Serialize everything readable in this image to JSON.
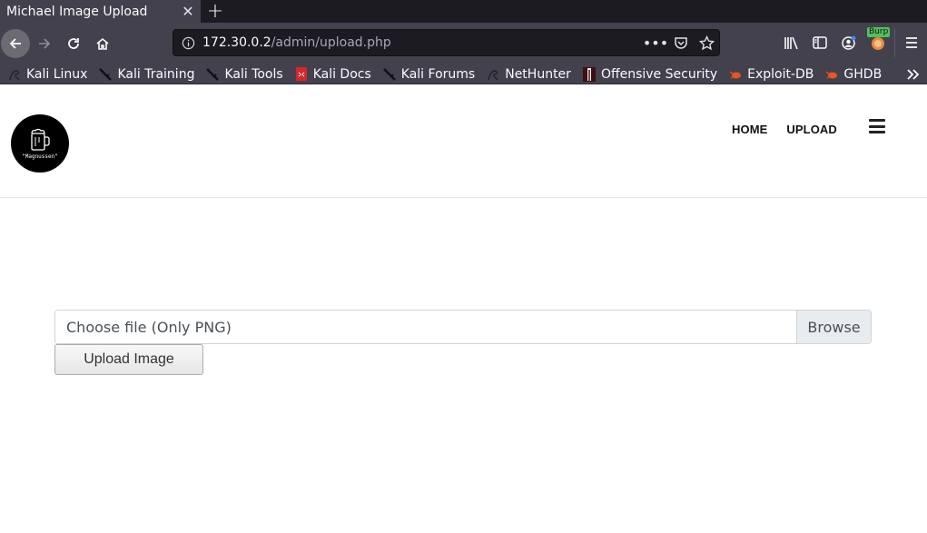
{
  "browser": {
    "tab": {
      "title": "Michael Image Upload",
      "close_icon": "close-icon"
    },
    "new_tab_icon": "plus-icon",
    "url": {
      "host": "172.30.0.2",
      "path": "/admin/upload.php"
    },
    "toolbar_icons": [
      "back-arrow-icon",
      "forward-arrow-icon",
      "reload-icon",
      "home-icon",
      "info-icon",
      "more-dots-icon",
      "pocket-icon",
      "star-icon",
      "library-icon",
      "sidebar-icon",
      "account-icon",
      "burp-extension-icon",
      "menu-icon"
    ],
    "burp_badge": "Burp",
    "bookmarks": [
      {
        "label": "Kali Linux",
        "icon": "kali-dragon-icon"
      },
      {
        "label": "Kali Training",
        "icon": "kali-sword-icon"
      },
      {
        "label": "Kali Tools",
        "icon": "kali-sword-icon"
      },
      {
        "label": "Kali Docs",
        "icon": "docs-book-icon"
      },
      {
        "label": "Kali Forums",
        "icon": "kali-sword-icon"
      },
      {
        "label": "NetHunter",
        "icon": "kali-dragon-icon"
      },
      {
        "label": "Offensive Security",
        "icon": "offsec-icon"
      },
      {
        "label": "Exploit-DB",
        "icon": "bug-icon"
      },
      {
        "label": "GHDB",
        "icon": "bug-icon"
      }
    ],
    "overflow_icon": "chevron-double-right-icon"
  },
  "header": {
    "logo_caption": "\"Magnussen\"",
    "nav": [
      {
        "label": "HOME"
      },
      {
        "label": "UPLOAD"
      }
    ]
  },
  "form": {
    "file_placeholder": "Choose file (Only PNG)",
    "browse_label": "Browse",
    "submit_label": "Upload Image"
  }
}
